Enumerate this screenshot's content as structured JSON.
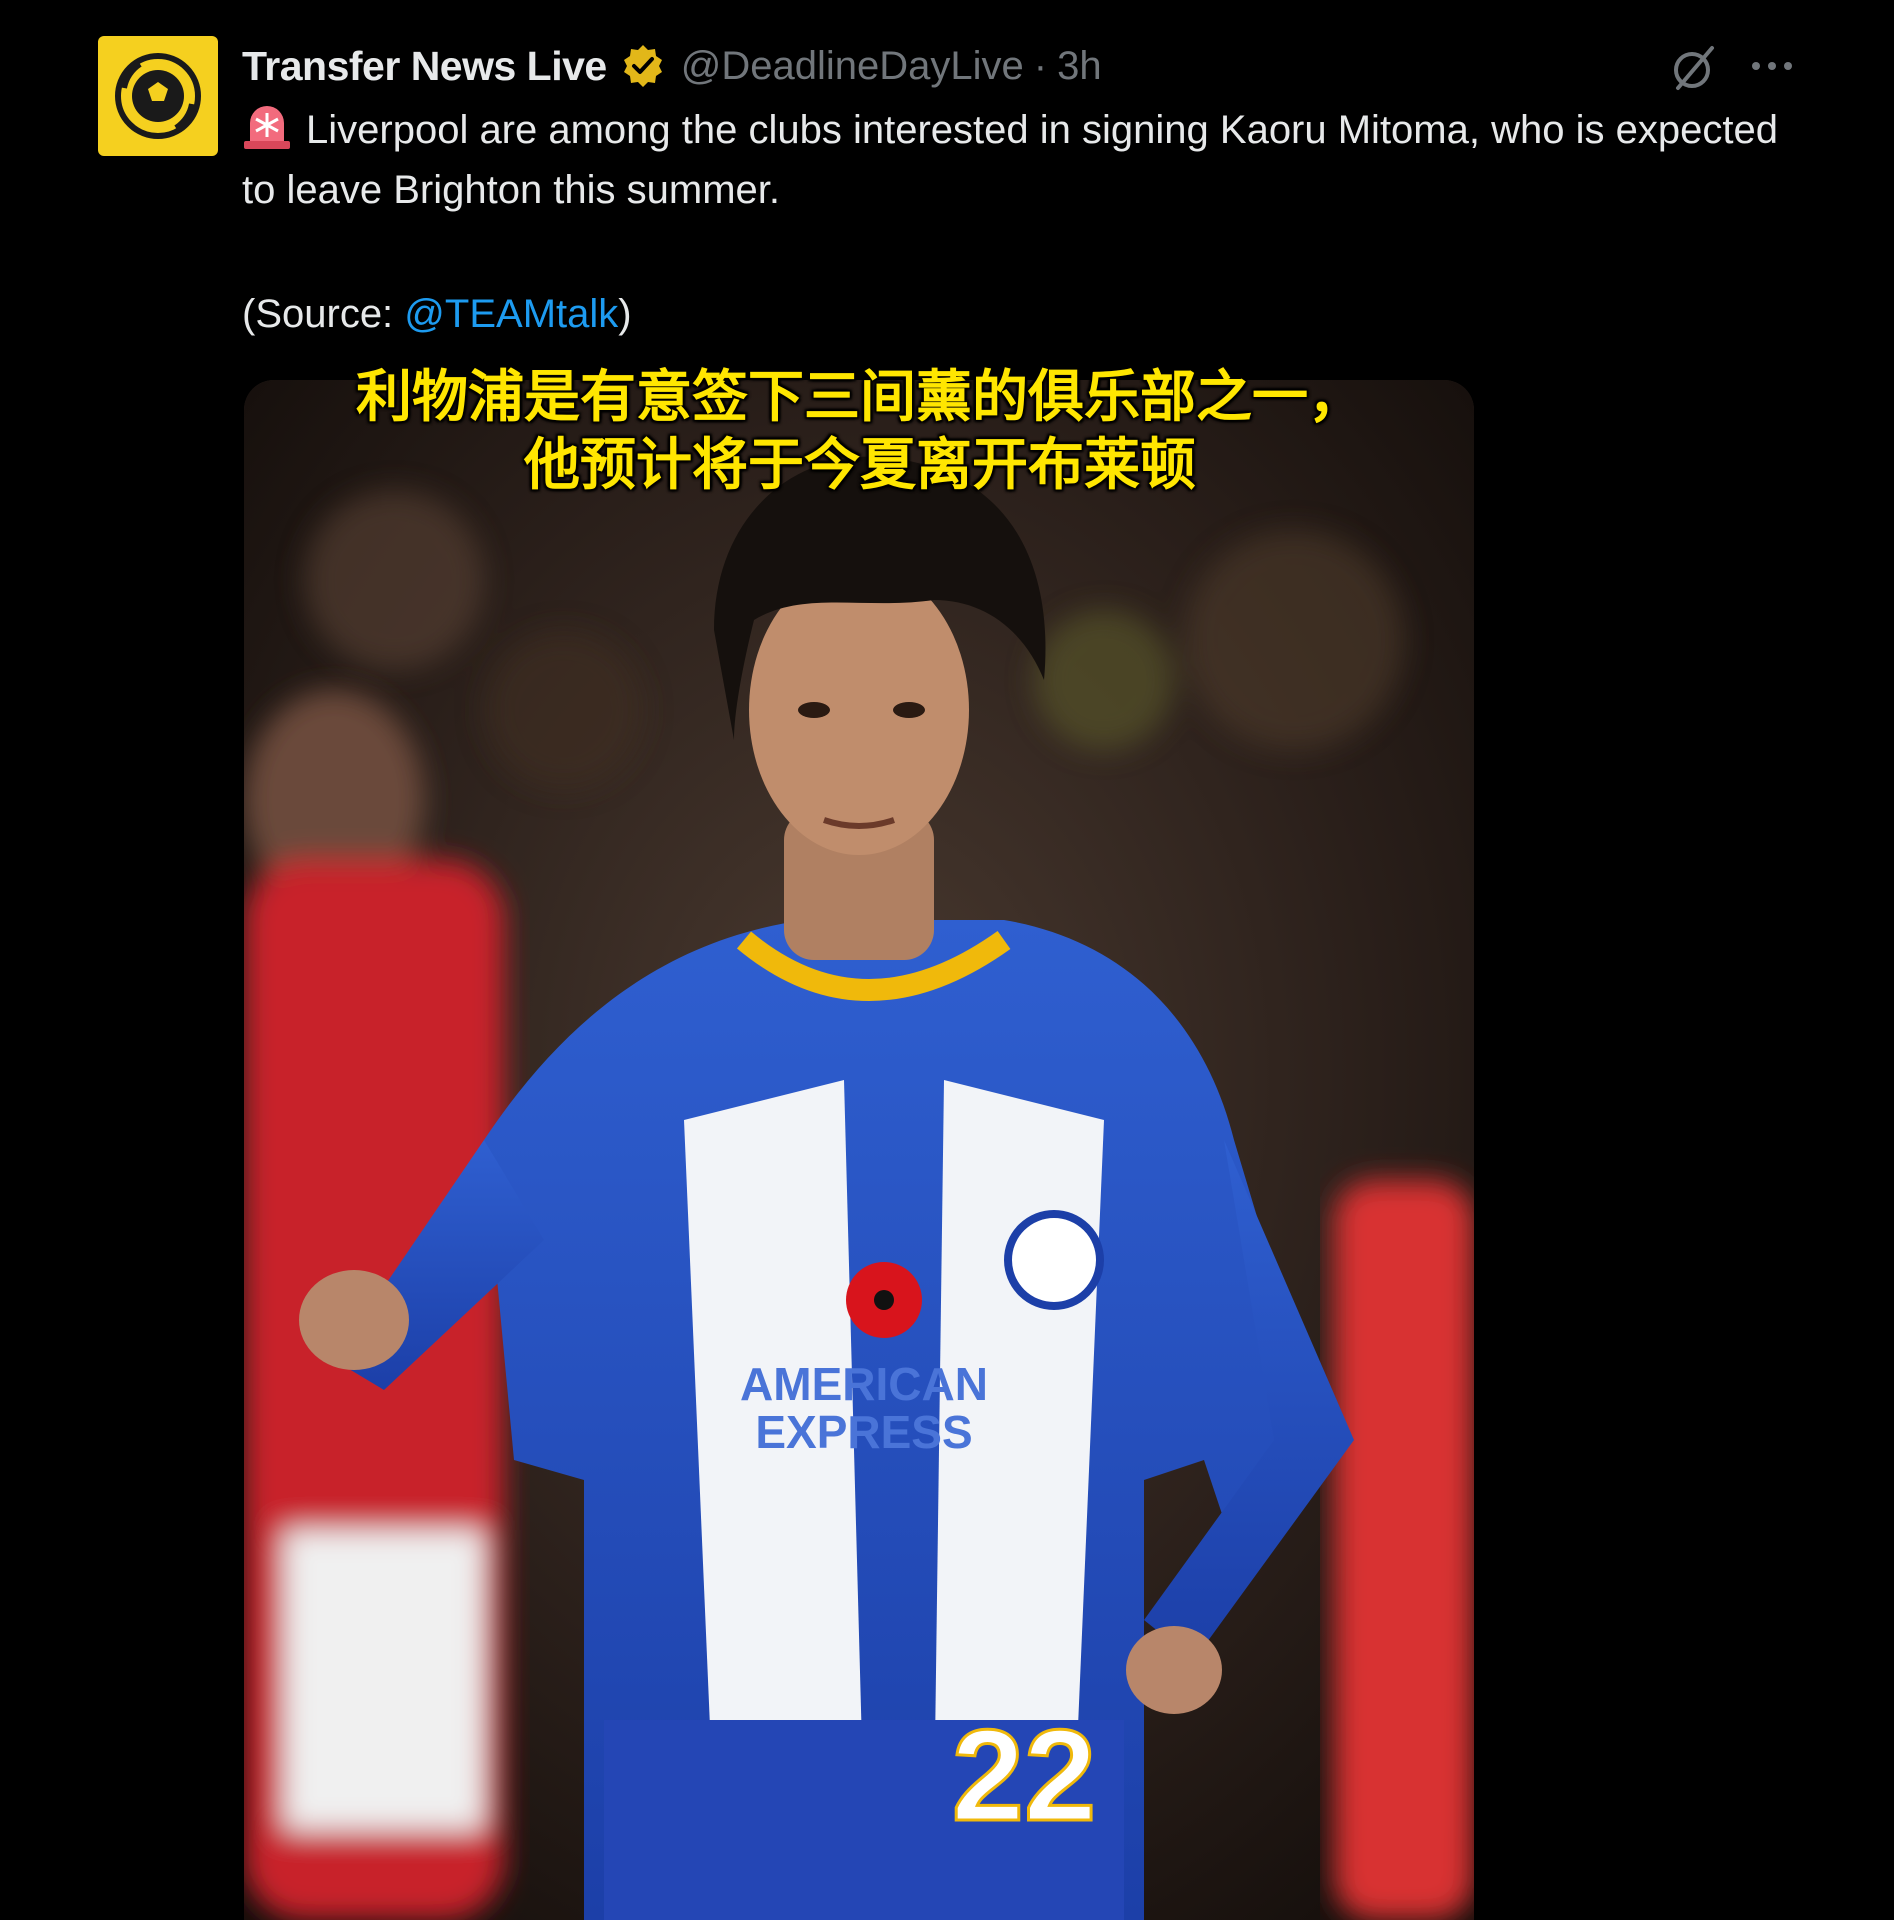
{
  "tweet": {
    "author_name": "Transfer News Live",
    "handle": "@DeadlineDayLive",
    "separator": "·",
    "time": "3h",
    "text": "Liverpool are among the clubs interested in signing Kaoru Mitoma, who is expected to leave Brighton this summer.",
    "source_prefix": "(Source: ",
    "source_link": "@TEAMtalk",
    "source_suffix": ")",
    "icons": {
      "avatar": "soccer-ball-logo-icon",
      "verified": "verified-badge-icon",
      "grok": "grok-icon",
      "more": "more-icon",
      "siren": "siren-emoji-icon"
    }
  },
  "media": {
    "shirt_number": "22",
    "sponsor_line1": "AMERICAN",
    "sponsor_line2": "EXPRESS"
  },
  "subtitle": {
    "line1": "利物浦是有意签下三间薰的俱乐部之一，",
    "line2": "他预计将于今夏离开布莱顿"
  },
  "colors": {
    "background": "#000000",
    "text": "#e7e9ea",
    "muted": "#71767b",
    "link": "#1d9bf0",
    "verified_gold": "#e2b719",
    "avatar_yellow": "#f5d01f",
    "subtitle_yellow": "#ffe600"
  }
}
